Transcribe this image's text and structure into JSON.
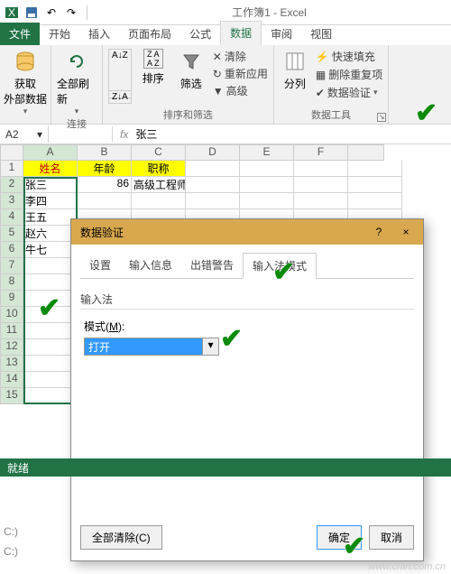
{
  "app": {
    "title": "工作簿1 - Excel"
  },
  "tabs": {
    "file": "文件",
    "home": "开始",
    "insert": "插入",
    "layout": "页面布局",
    "formula": "公式",
    "data": "数据",
    "review": "审阅",
    "view": "视图"
  },
  "ribbon": {
    "get_ext": "获取\n外部数据",
    "refresh": "全部刷新",
    "conn_group": "连接",
    "sort": "排序",
    "filter": "筛选",
    "clear": "清除",
    "reapply": "重新应用",
    "advanced": "高级",
    "sortfilter_group": "排序和筛选",
    "split": "分列",
    "fastfill": "快速填充",
    "dedup": "删除重复项",
    "validation": "数据验证",
    "tools_group": "数据工具"
  },
  "namebox": {
    "ref": "A2",
    "fx_value": "张三"
  },
  "headers": {
    "name": "姓名",
    "age": "年龄",
    "title": "职称"
  },
  "data_rows": [
    {
      "name": "张三",
      "age": "86",
      "title": "高级工程师"
    },
    {
      "name": "李四"
    },
    {
      "name": "王五"
    },
    {
      "name": "赵六"
    },
    {
      "name": "牛七"
    }
  ],
  "dialog": {
    "title": "数据验证",
    "help": "?",
    "close": "×",
    "tab_settings": "设置",
    "tab_input": "输入信息",
    "tab_error": "出错警告",
    "tab_ime": "输入法模式",
    "group_label": "输入法",
    "mode_label_pre": "模式(",
    "mode_label_key": "M",
    "mode_label_post": "):",
    "dd_value": "打开",
    "clear_all": "全部清除(C)",
    "ok": "确定",
    "cancel": "取消"
  },
  "status": {
    "ready": "就绪"
  },
  "misc": {
    "c_colon": "C:)",
    "watermark": "www.cfan.com.cn"
  },
  "chart_data": null
}
